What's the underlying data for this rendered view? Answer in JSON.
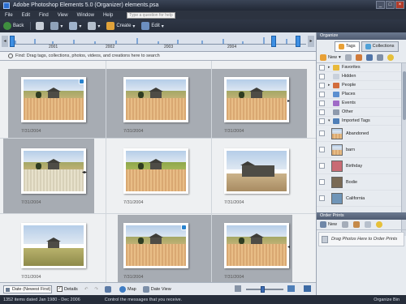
{
  "window": {
    "title": "Adobe Photoshop Elements 5.0 (Organizer)    elements.psa",
    "min": "_",
    "max": "□",
    "close": "×"
  },
  "menu": {
    "items": [
      "File",
      "Edit",
      "Find",
      "View",
      "Window",
      "Help"
    ],
    "help_placeholder": "Type a question for help"
  },
  "toolbar": {
    "back": "Back",
    "create": "Create",
    "edit": "Edit"
  },
  "timeline": {
    "years": [
      "2001",
      "2002",
      "2003",
      "2004"
    ]
  },
  "find": {
    "text": "Find: Drag tags, collections, photos, videos, and creations here to search"
  },
  "photos": [
    {
      "date": "7/31/2004"
    },
    {
      "date": "7/31/2004"
    },
    {
      "date": "7/31/2004"
    },
    {
      "date": "7/31/2004"
    },
    {
      "date": "7/31/2004"
    },
    {
      "date": "7/31/2004"
    },
    {
      "date": "7/31/2004"
    },
    {
      "date": "7/31/2004"
    },
    {
      "date": "7/31/2004"
    }
  ],
  "bottom": {
    "sort": "Date (Newest First)",
    "details": "Details",
    "map": "Map",
    "date_view": "Date View"
  },
  "status": {
    "count": "1352 items dated Jan 1980 - Dec 2006",
    "message": "Control the messages that you receive.",
    "bin": "Organize Bin"
  },
  "panel": {
    "title": "Organize",
    "tab_tags": "Tags",
    "tab_collections": "Collections",
    "new": "New",
    "tags": [
      {
        "label": "Favorites",
        "color": "#e8b93a"
      },
      {
        "label": "Hidden",
        "color": "#c9d1dc"
      },
      {
        "label": "People",
        "color": "#d26c3c"
      },
      {
        "label": "Places",
        "color": "#5b8fd0"
      },
      {
        "label": "Events",
        "color": "#a06bc7"
      },
      {
        "label": "Other",
        "color": "#8e9aad"
      },
      {
        "label": "Imported Tags",
        "color": "#4f7fb8"
      }
    ],
    "image_tags": [
      "Abandoned",
      "barn",
      "Birthday",
      "Bodie",
      "California"
    ],
    "order_title": "Order Prints",
    "order_new": "New",
    "order_drop": "Drag Photos Here to Order Prints"
  }
}
